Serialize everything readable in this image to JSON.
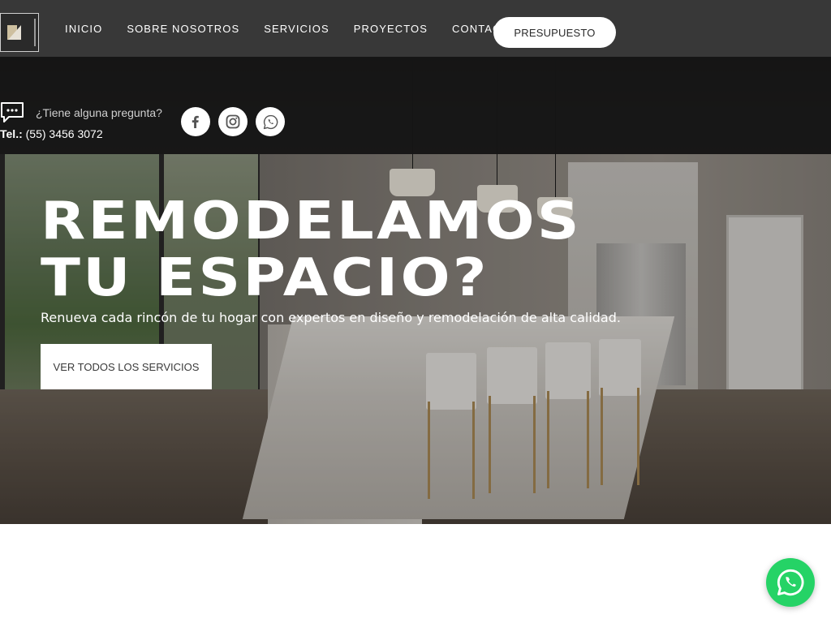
{
  "nav": {
    "items": [
      {
        "label": "INICIO"
      },
      {
        "label": "SOBRE NOSOTROS"
      },
      {
        "label": "SERVICIOS"
      },
      {
        "label": "PROYECTOS"
      },
      {
        "label": "CONTACTO"
      }
    ],
    "cta_label": "PRESUPUESTO"
  },
  "info": {
    "question": "¿Tiene alguna pregunta?",
    "tel_label": "Tel.:",
    "tel_number": "(55) 3456 3072"
  },
  "social": [
    {
      "icon": "facebook-icon"
    },
    {
      "icon": "instagram-icon"
    },
    {
      "icon": "whatsapp-icon"
    }
  ],
  "hero": {
    "headline_line1": "REMODELAMOS",
    "headline_line2": "TU ESPACIO?",
    "subtitle": "Renueva cada rincón de tu hogar con expertos en diseño y remodelación de alta calidad.",
    "button_label": "VER TODOS LOS SERVICIOS"
  },
  "colors": {
    "topbar": "#383838",
    "whatsapp": "#25d366",
    "text_light": "#ffffff"
  }
}
